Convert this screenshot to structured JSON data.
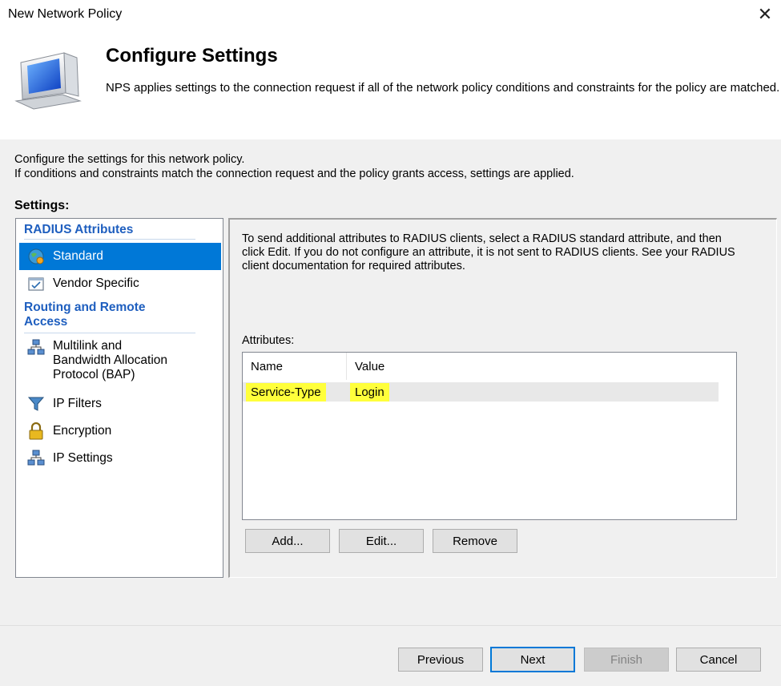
{
  "window": {
    "title": "New Network Policy",
    "close_glyph": "✕"
  },
  "header": {
    "title": "Configure Settings",
    "description": "NPS applies settings to the connection request if all of the network policy conditions and constraints for the policy are matched."
  },
  "intro": {
    "line1": "Configure the settings for this network policy.",
    "line2": "If conditions and constraints match the connection request and the policy grants access, settings are applied."
  },
  "settings_label": "Settings:",
  "nav": {
    "group1": "RADIUS Attributes",
    "standard": "Standard",
    "vendor": "Vendor Specific",
    "group2_line1": "Routing and Remote",
    "group2_line2": "Access",
    "multilink_line1": "Multilink and",
    "multilink_line2": "Bandwidth Allocation",
    "multilink_line3": "Protocol (BAP)",
    "ipfilters": "IP Filters",
    "encryption": "Encryption",
    "ipsettings": "IP Settings"
  },
  "right": {
    "description": "To send additional attributes to RADIUS clients, select a RADIUS standard attribute, and then click Edit. If you do not configure an attribute, it is not sent to RADIUS clients. See your RADIUS client documentation for required attributes.",
    "attributes_label": "Attributes:",
    "columns": {
      "name": "Name",
      "value": "Value"
    },
    "rows": [
      {
        "name": "Service-Type",
        "value": "Login"
      }
    ],
    "add": "Add...",
    "edit": "Edit...",
    "remove": "Remove"
  },
  "footer": {
    "previous": "Previous",
    "next": "Next",
    "finish": "Finish",
    "cancel": "Cancel"
  },
  "colors": {
    "selection": "#0078d7",
    "group_heading": "#1f5fbf",
    "highlight": "#ffff3b"
  }
}
